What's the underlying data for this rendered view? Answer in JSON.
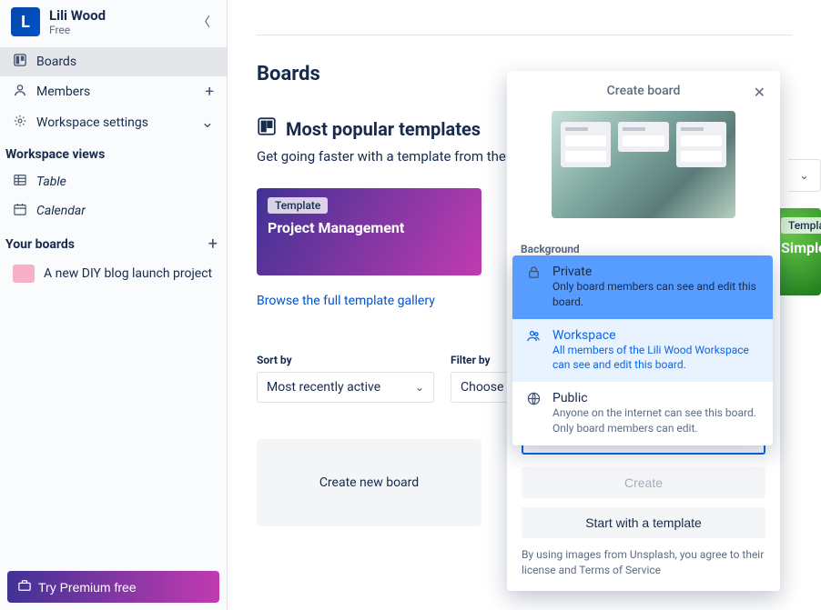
{
  "workspace": {
    "initial": "L",
    "name": "Lili Wood",
    "plan": "Free"
  },
  "sidebar": {
    "items": [
      {
        "label": "Boards",
        "active": true,
        "trailing": null
      },
      {
        "label": "Members",
        "active": false,
        "trailing": "+"
      },
      {
        "label": "Workspace settings",
        "active": false,
        "trailing": "⌄"
      }
    ],
    "views_title": "Workspace views",
    "views": [
      {
        "label": "Table"
      },
      {
        "label": "Calendar"
      }
    ],
    "boards_title": "Your boards",
    "boards": [
      {
        "label": "A new DIY blog launch project",
        "color": "#f8b0c7"
      }
    ],
    "premium_cta": "Try Premium free"
  },
  "main": {
    "title": "Boards",
    "templates_header": "Most popular templates",
    "templates_sub": "Get going faster with a template from the Trello community or",
    "templates": [
      {
        "badge": "Template",
        "title": "Project Management"
      },
      {
        "badge": "Template",
        "title": "Simple"
      }
    ],
    "browse_link": "Browse the full template gallery",
    "sort_label": "Sort by",
    "sort_value": "Most recently active",
    "filter_label": "Filter by",
    "filter_value": "Choose a collection",
    "create_tile": "Create new board"
  },
  "popover": {
    "title": "Create board",
    "background_label": "Background",
    "visibility_value": "Workspace",
    "create_btn": "Create",
    "template_btn": "Start with a template",
    "fine_print": "By using images from Unsplash, you agree to their license and Terms of Service"
  },
  "visibility_options": [
    {
      "title": "Private",
      "desc": "Only board members can see and edit this board."
    },
    {
      "title": "Workspace",
      "desc": "All members of the Lili Wood Workspace can see and edit this board."
    },
    {
      "title": "Public",
      "desc": "Anyone on the internet can see this board. Only board members can edit."
    }
  ]
}
